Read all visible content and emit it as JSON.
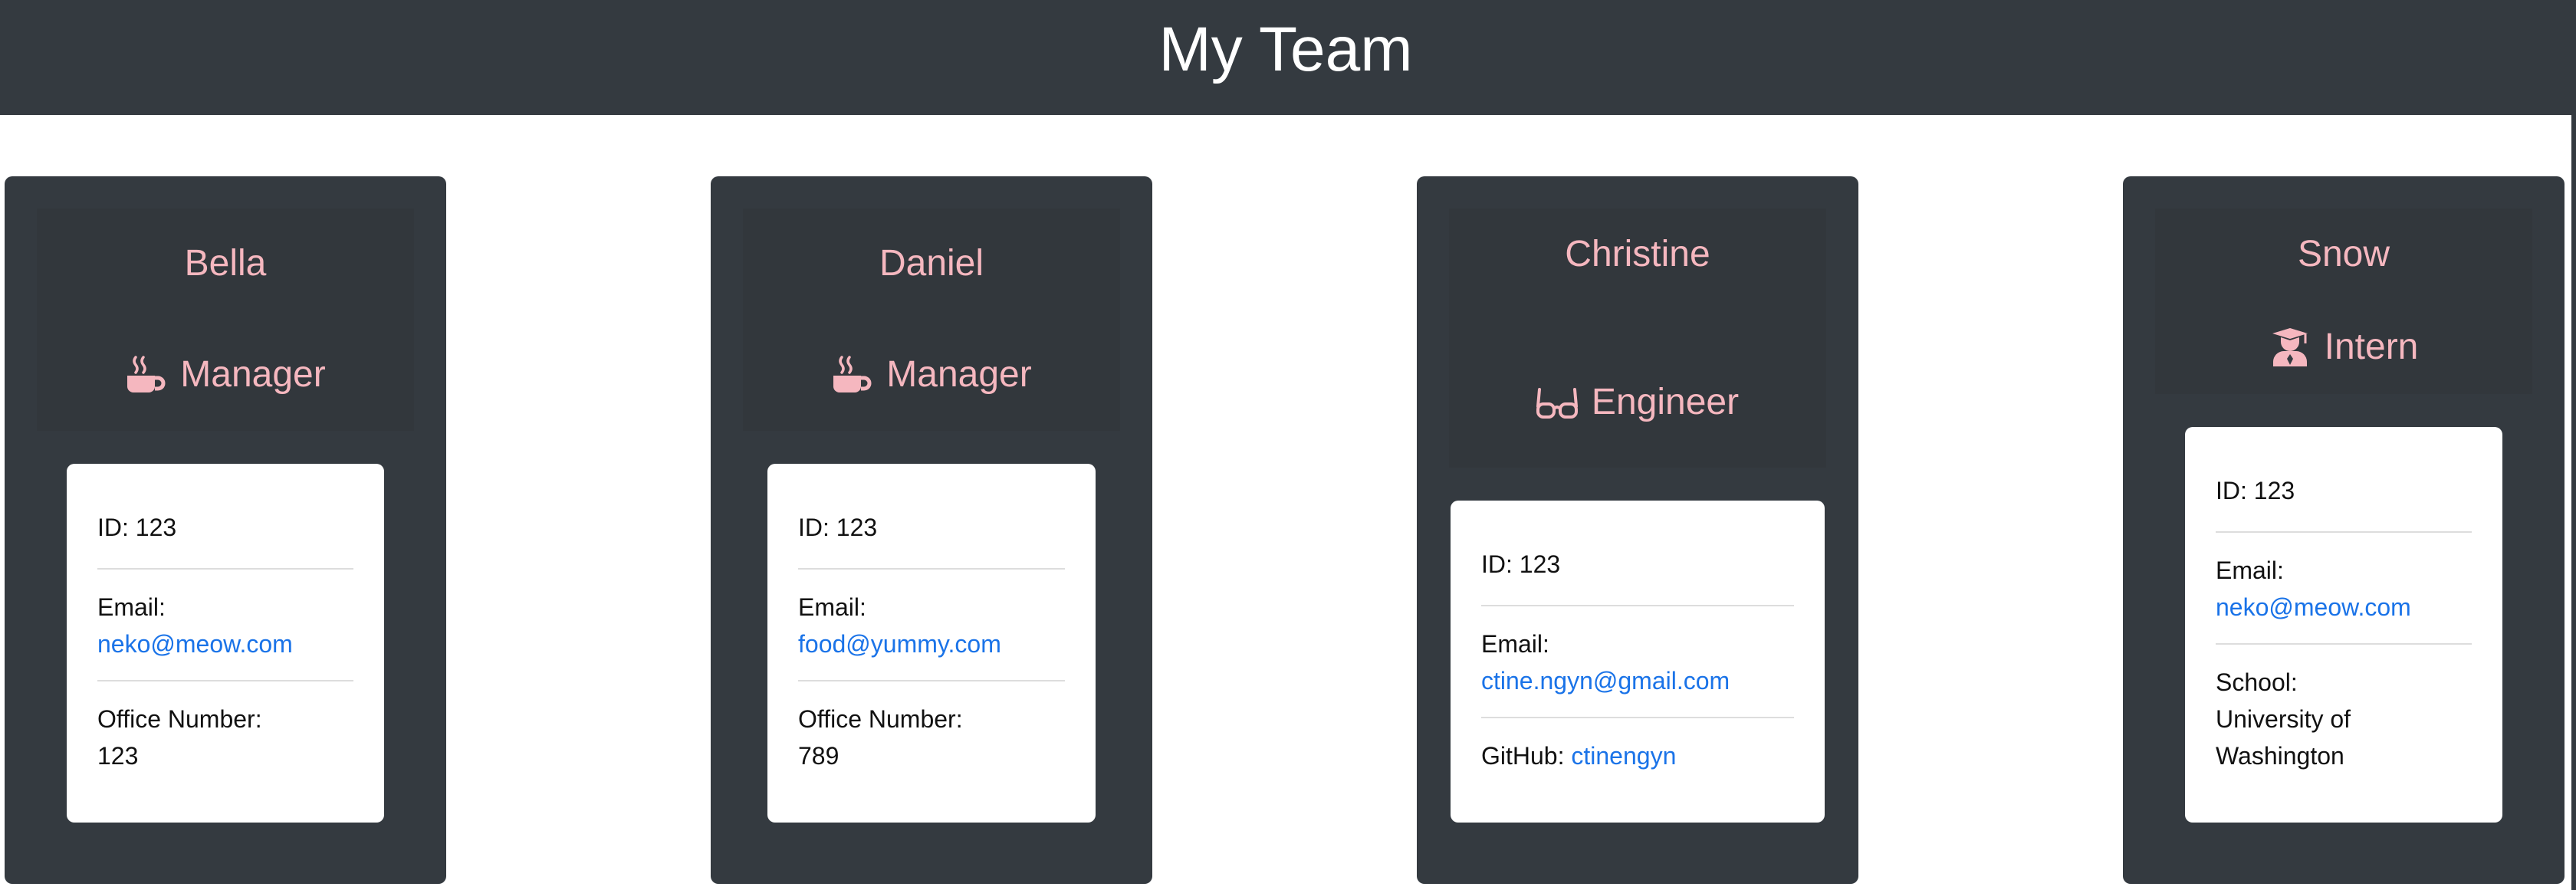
{
  "page": {
    "title": "My Team"
  },
  "colors": {
    "banner": "#343a40",
    "card": "#343a40",
    "accent": "#f5b7bf",
    "link": "#1a73e8"
  },
  "employees": [
    {
      "name": "Bella",
      "role": "Manager",
      "role_icon": "coffee-mug-icon",
      "id_label": "ID: 123",
      "email_label": "Email:",
      "email": "neko@meow.com",
      "extra_label": "Office Number:",
      "extra_value": "123"
    },
    {
      "name": "Daniel",
      "role": "Manager",
      "role_icon": "coffee-mug-icon",
      "id_label": "ID: 123",
      "email_label": "Email:",
      "email": "food@yummy.com",
      "extra_label": "Office Number:",
      "extra_value": "789"
    },
    {
      "name": "Christine",
      "role": "Engineer",
      "role_icon": "glasses-icon",
      "id_label": "ID: 123",
      "email_label": "Email:",
      "email": "ctine.ngyn@gmail.com",
      "extra_label": "GitHub:",
      "extra_value": "ctinengyn"
    },
    {
      "name": "Snow",
      "role": "Intern",
      "role_icon": "graduate-icon",
      "id_label": "ID: 123",
      "email_label": "Email:",
      "email": "neko@meow.com",
      "extra_label": "School:",
      "extra_value": "University of",
      "extra_value_2": "Washington"
    }
  ]
}
